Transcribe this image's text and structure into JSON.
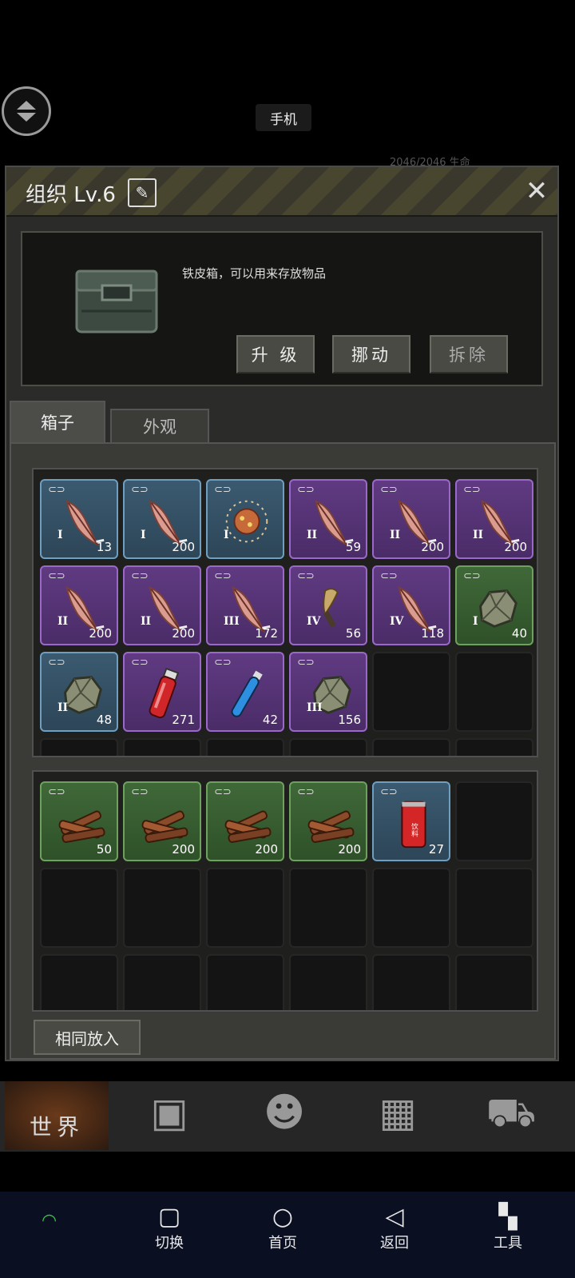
{
  "topbar": {
    "phone_label": "手机",
    "bg_stats": "2046/2046  生命"
  },
  "panel": {
    "title": "组织 Lv.6",
    "description": "铁皮箱，可以用来存放物品",
    "buttons": {
      "upgrade": "升 级",
      "move": "挪动",
      "dismantle": "拆除"
    },
    "tabs": {
      "box": "箱子",
      "appearance": "外观"
    },
    "same_put_label": "相同放入"
  },
  "storage_slots": [
    {
      "color": "blue",
      "item": "feather",
      "tier": "I",
      "qty": "13"
    },
    {
      "color": "blue",
      "item": "feather",
      "tier": "I",
      "qty": "200"
    },
    {
      "color": "blue",
      "item": "spore",
      "tier": "I",
      "qty": ""
    },
    {
      "color": "purple",
      "item": "feather",
      "tier": "II",
      "qty": "59"
    },
    {
      "color": "purple",
      "item": "feather",
      "tier": "II",
      "qty": "200"
    },
    {
      "color": "purple",
      "item": "feather",
      "tier": "II",
      "qty": "200"
    },
    {
      "color": "purple",
      "item": "feather",
      "tier": "II",
      "qty": "200"
    },
    {
      "color": "purple",
      "item": "feather",
      "tier": "II",
      "qty": "200"
    },
    {
      "color": "purple",
      "item": "feather",
      "tier": "III",
      "qty": "172"
    },
    {
      "color": "purple",
      "item": "claw",
      "tier": "IV",
      "qty": "56"
    },
    {
      "color": "purple",
      "item": "feather",
      "tier": "IV",
      "qty": "118"
    },
    {
      "color": "green",
      "item": "rock",
      "tier": "I",
      "qty": "40"
    },
    {
      "color": "blue",
      "item": "rock",
      "tier": "II",
      "qty": "48"
    },
    {
      "color": "purple",
      "item": "red-vial",
      "tier": "",
      "qty": "271"
    },
    {
      "color": "purple",
      "item": "blue-vial",
      "tier": "",
      "qty": "42"
    },
    {
      "color": "purple",
      "item": "rock",
      "tier": "III",
      "qty": "156"
    },
    {
      "color": "empty"
    },
    {
      "color": "empty"
    }
  ],
  "inventory_slots": [
    {
      "color": "green",
      "item": "wood",
      "tier": "",
      "qty": "50"
    },
    {
      "color": "green",
      "item": "wood",
      "tier": "",
      "qty": "200"
    },
    {
      "color": "green",
      "item": "wood",
      "tier": "",
      "qty": "200"
    },
    {
      "color": "green",
      "item": "wood",
      "tier": "",
      "qty": "200"
    },
    {
      "color": "blue",
      "item": "can",
      "tier": "",
      "qty": "27"
    },
    {
      "color": "empty"
    },
    {
      "color": "empty"
    },
    {
      "color": "empty"
    },
    {
      "color": "empty"
    },
    {
      "color": "empty"
    },
    {
      "color": "empty"
    },
    {
      "color": "empty"
    },
    {
      "color": "empty"
    },
    {
      "color": "empty"
    },
    {
      "color": "empty"
    },
    {
      "color": "empty"
    },
    {
      "color": "empty"
    },
    {
      "color": "empty"
    }
  ],
  "can_label": "饮料",
  "game_bar": {
    "world": "世界"
  },
  "system_nav": {
    "switch": "切换",
    "home": "首页",
    "back": "返回",
    "tools": "工具"
  }
}
